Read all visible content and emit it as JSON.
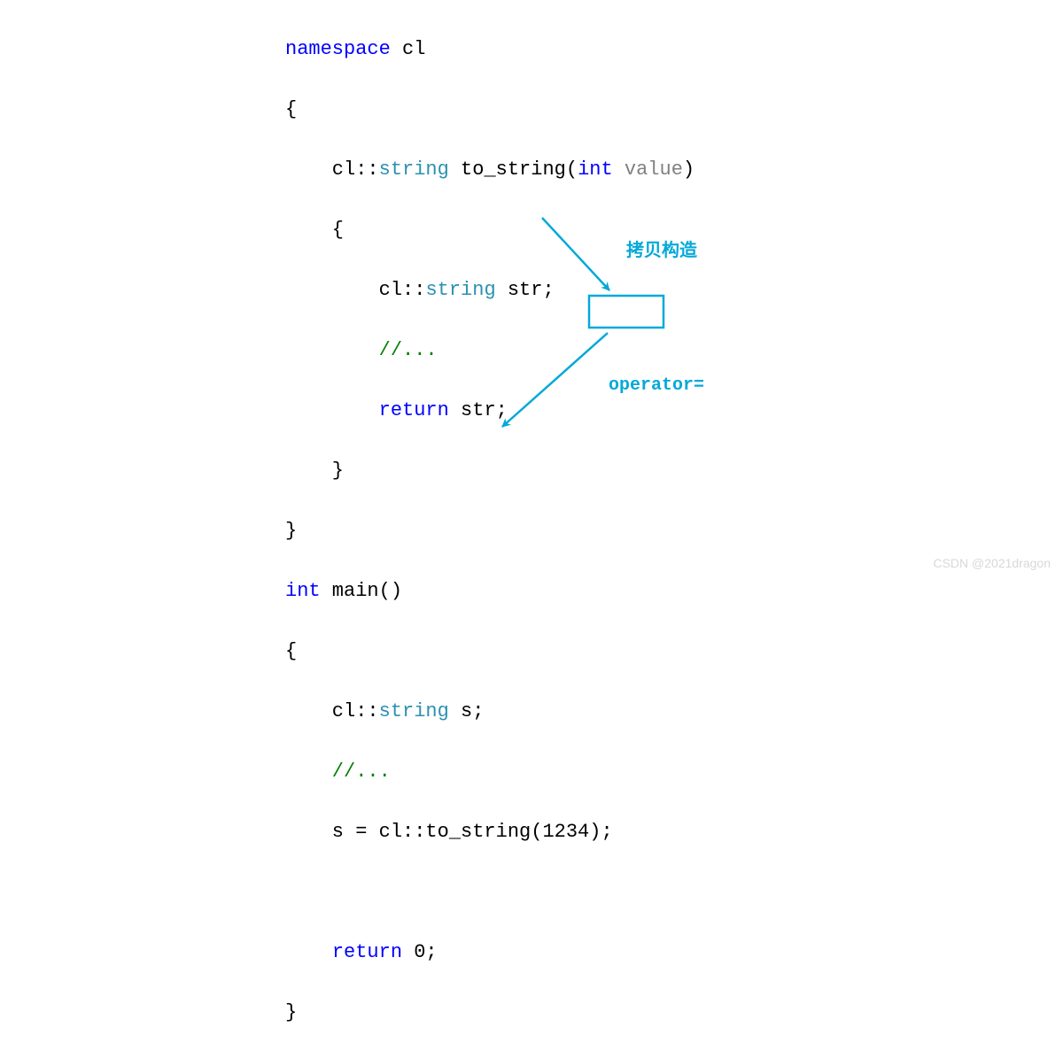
{
  "code": {
    "l1_kw_namespace": "namespace",
    "l1_ns": " cl",
    "l2_brace": "{",
    "l3_indent": "    cl::",
    "l3_type": "string",
    "l3_fn": " to_string(",
    "l3_int": "int",
    "l3_sp": " ",
    "l3_param": "value",
    "l3_close": ")",
    "l4_brace": "    {",
    "l5_indent": "        cl::",
    "l5_type": "string",
    "l5_var": " str;",
    "l6_comment": "        //...",
    "l7_indent": "        ",
    "l7_return": "return",
    "l7_var": " str;",
    "l8_brace": "    }",
    "l9_brace": "}",
    "l10_int": "int",
    "l10_main": " main()",
    "l11_brace": "{",
    "l12_indent": "    cl::",
    "l12_type": "string",
    "l12_var": " s;",
    "l13_comment": "    //...",
    "l14_expr": "    s = cl::to_string(1234);",
    "l15_blank": "",
    "l16_indent": "    ",
    "l16_return": "return",
    "l16_val": " 0;",
    "l17_brace": "}"
  },
  "annotations": {
    "copy_ctor": "拷贝构造",
    "operator_eq": "operator="
  },
  "watermark": "CSDN @2021dragon",
  "colors": {
    "accent": "#03a9d9"
  }
}
